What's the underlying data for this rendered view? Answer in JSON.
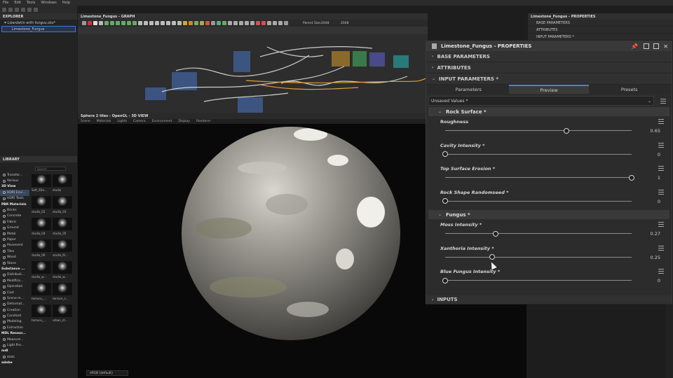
{
  "menubar": [
    "File",
    "Edit",
    "Tools",
    "Windows",
    "Help"
  ],
  "explorer": {
    "title": "EXPLORER",
    "package": "Lizardskin with fungus.sbs*",
    "graph": "Limestone_Fungus"
  },
  "library": {
    "title": "LIBRARY",
    "search_placeholder": "Search",
    "tree": [
      {
        "label": "Transfor...",
        "head": false
      },
      {
        "label": "Various",
        "head": false
      },
      {
        "label": "3D View",
        "head": true
      },
      {
        "label": "HDRI Envi...",
        "head": false,
        "hl": true
      },
      {
        "label": "HDRI Tools",
        "head": false
      },
      {
        "label": "PBR Materials",
        "head": true
      },
      {
        "label": "Bricks",
        "head": false
      },
      {
        "label": "Concrete",
        "head": false
      },
      {
        "label": "Fabric",
        "head": false
      },
      {
        "label": "Ground",
        "head": false
      },
      {
        "label": "Metal",
        "head": false
      },
      {
        "label": "Paper",
        "head": false
      },
      {
        "label": "Pavement",
        "head": false
      },
      {
        "label": "Tiles",
        "head": false
      },
      {
        "label": "Wood",
        "head": false
      },
      {
        "label": "Stone",
        "head": false
      },
      {
        "label": "Substance ...",
        "head": true
      },
      {
        "label": "Distributi...",
        "head": false
      },
      {
        "label": "Modifica...",
        "head": false
      },
      {
        "label": "Operation",
        "head": false
      },
      {
        "label": "Cast",
        "head": false
      },
      {
        "label": "Scene m...",
        "head": false
      },
      {
        "label": "Deformat...",
        "head": false
      },
      {
        "label": "Creation",
        "head": false
      },
      {
        "label": "Constant",
        "head": false
      },
      {
        "label": "Modeling",
        "head": false
      },
      {
        "label": "Extraction",
        "head": false
      },
      {
        "label": "MDL Resour...",
        "head": true
      },
      {
        "label": "Measure...",
        "head": false
      },
      {
        "label": "Light Pro...",
        "head": false
      },
      {
        "label": "mdl",
        "head": true
      },
      {
        "label": "stats",
        "head": false
      },
      {
        "label": "adobe",
        "head": true
      }
    ],
    "thumbs": [
      "Soft_SDa...",
      "studio",
      "studio_02",
      "studio_03",
      "studio_04",
      "studio_05",
      "studio_06",
      "studio_M...",
      "studio_w...",
      "studio_w...",
      "tomoco_...",
      "terrace_n...",
      "tomoco_...",
      "urban_st..."
    ]
  },
  "graph": {
    "title": "Limestone_Fungus - GRAPH",
    "parent_size_label": "Parent Size:",
    "parent_size": "2048",
    "size_value": "2048"
  },
  "view3d": {
    "title": "Sphere 2 tiles - OpenGL - 3D VIEW",
    "menu": [
      "Scene",
      "Materials",
      "Lights",
      "Camera",
      "Environment",
      "Display",
      "Renderer"
    ],
    "colorspace": "sRGB (default)"
  },
  "properties_dock": {
    "title": "Limestone_Fungus - PROPERTIES",
    "rows": [
      "BASE PARAMETERS",
      "ATTRIBUTES",
      "INPUT PARAMETERS *"
    ]
  },
  "properties": {
    "title": "Limestone_Fungus - PROPERTIES",
    "sections": {
      "base": "BASE PARAMETERS",
      "attributes": "ATTRIBUTES",
      "input": "INPUT PARAMETERS *",
      "inputs": "INPUTS"
    },
    "tabs": [
      "Parameters",
      "Preview",
      "Presets"
    ],
    "active_tab": "Preview",
    "preset": "Unsaved Values *",
    "groups": [
      {
        "title": "Rock Surface *",
        "params": [
          {
            "label": "Roughness",
            "value": "0.65",
            "fraction": 0.65,
            "italic": false
          },
          {
            "label": "Cavity Intensity *",
            "value": "0",
            "fraction": 0,
            "italic": true
          },
          {
            "label": "Top Surface Erosion *",
            "value": "1",
            "fraction": 1,
            "italic": true
          },
          {
            "label": "Rock Shape Randomseed *",
            "value": "0",
            "fraction": 0,
            "italic": true
          }
        ]
      },
      {
        "title": "Fungus *",
        "params": [
          {
            "label": "Moss Intensity *",
            "value": "0.27",
            "fraction": 0.27,
            "italic": true
          },
          {
            "label": "Xanthoria Intensity *",
            "value": "0.25",
            "fraction": 0.25,
            "italic": true
          },
          {
            "label": "Blue Fungus Intensity *",
            "value": "0",
            "fraction": 0,
            "italic": true
          }
        ]
      }
    ]
  },
  "colors": {
    "accent": "#3f83e0",
    "panel": "#2c2c2c"
  }
}
